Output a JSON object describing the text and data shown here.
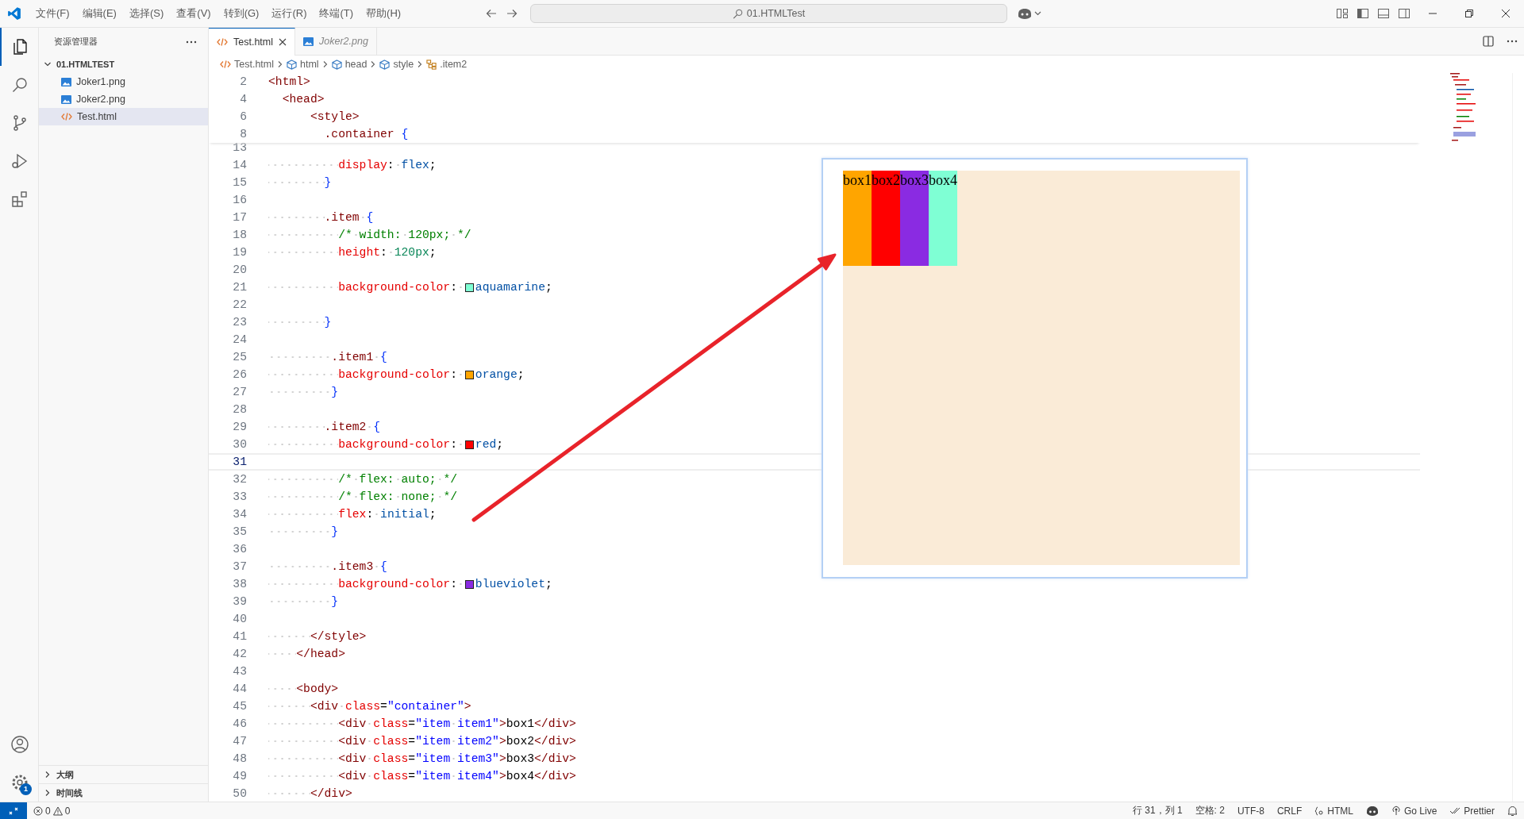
{
  "title_bar": {
    "menus": [
      "文件(F)",
      "编辑(E)",
      "选择(S)",
      "查看(V)",
      "转到(G)",
      "运行(R)",
      "终端(T)",
      "帮助(H)"
    ],
    "command_center": {
      "text": "01.HTMLTest"
    }
  },
  "activity_bar": {
    "items": [
      {
        "kind": "explorer",
        "selected": true
      },
      {
        "kind": "search",
        "selected": false
      },
      {
        "kind": "source-control",
        "selected": false
      },
      {
        "kind": "run-debug",
        "selected": false
      },
      {
        "kind": "extensions",
        "selected": false
      }
    ],
    "bottom": [
      {
        "kind": "account"
      },
      {
        "kind": "settings",
        "badge": "1"
      }
    ]
  },
  "sidebar": {
    "title": "资源管理器",
    "folder": {
      "label": "01.HTMLTEST",
      "expanded": true,
      "children": [
        {
          "label": "Joker1.png",
          "kind": "image",
          "selected": false
        },
        {
          "label": "Joker2.png",
          "kind": "image",
          "selected": false
        },
        {
          "label": "Test.html",
          "kind": "html",
          "selected": true
        }
      ]
    },
    "sections": [
      {
        "label": "大纲",
        "expanded": false
      },
      {
        "label": "时间线",
        "expanded": false
      }
    ]
  },
  "tabs": [
    {
      "label": "Test.html",
      "kind": "html",
      "selected": true,
      "preview": false
    },
    {
      "label": "Joker2.png",
      "kind": "image",
      "selected": false,
      "preview": true
    }
  ],
  "breadcrumb": [
    {
      "label": "Test.html",
      "kind": "html"
    },
    {
      "label": "html",
      "kind": "element"
    },
    {
      "label": "head",
      "kind": "element"
    },
    {
      "label": "style",
      "kind": "element"
    },
    {
      "label": ".item2",
      "kind": "selector"
    }
  ],
  "editor": {
    "sticky_lines": [
      {
        "number": "2",
        "text": "<html>"
      },
      {
        "number": "4",
        "text": "  <head>"
      },
      {
        "number": "6",
        "text": "      <style>"
      },
      {
        "number": "8",
        "text": "        .container {"
      }
    ],
    "lines": [
      {
        "number": "13",
        "current": false
      },
      {
        "number": "14",
        "current": false,
        "text": "          display: flex;"
      },
      {
        "number": "15",
        "current": false,
        "text": "        }"
      },
      {
        "number": "16",
        "current": false
      },
      {
        "number": "17",
        "current": false,
        "text": "        .item {"
      },
      {
        "number": "18",
        "current": false,
        "text": "          /* width: 120px; */"
      },
      {
        "number": "19",
        "current": false,
        "text": "          height: 120px;"
      },
      {
        "number": "20",
        "current": false
      },
      {
        "number": "21",
        "current": false,
        "text": "          background-color: aquamarine;",
        "swatch": {
          "color": "#7fffd4"
        }
      },
      {
        "number": "22",
        "current": false
      },
      {
        "number": "23",
        "current": false,
        "text": "        }"
      },
      {
        "number": "24",
        "current": false
      },
      {
        "number": "25",
        "current": false,
        "text": "         .item1 {"
      },
      {
        "number": "26",
        "current": false,
        "text": "          background-color: orange;",
        "swatch": {
          "color": "#ffa500"
        }
      },
      {
        "number": "27",
        "current": false,
        "text": "         }"
      },
      {
        "number": "28",
        "current": false
      },
      {
        "number": "29",
        "current": false,
        "text": "        .item2 {"
      },
      {
        "number": "30",
        "current": false,
        "text": "          background-color: red;",
        "swatch": {
          "color": "#ff0000"
        }
      },
      {
        "number": "31",
        "current": true
      },
      {
        "number": "32",
        "current": false,
        "text": "          /* flex: auto; */"
      },
      {
        "number": "33",
        "current": false,
        "text": "          /* flex: none; */"
      },
      {
        "number": "34",
        "current": false,
        "text": "          flex: initial;"
      },
      {
        "number": "35",
        "current": false,
        "text": "         }"
      },
      {
        "number": "36",
        "current": false
      },
      {
        "number": "37",
        "current": false,
        "text": "         .item3 {"
      },
      {
        "number": "38",
        "current": false,
        "text": "          background-color: blueviolet;",
        "swatch": {
          "color": "#8a2be2"
        }
      },
      {
        "number": "39",
        "current": false,
        "text": "         }"
      },
      {
        "number": "40",
        "current": false
      },
      {
        "number": "41",
        "current": false,
        "text": "      </style>"
      },
      {
        "number": "42",
        "current": false,
        "text": "    </head>"
      },
      {
        "number": "43",
        "current": false
      },
      {
        "number": "44",
        "current": false,
        "text": "    <body>"
      },
      {
        "number": "45",
        "current": false,
        "text": "      <div class=\"container\">"
      },
      {
        "number": "46",
        "current": false,
        "text": "          <div class=\"item item1\">box1</div>"
      },
      {
        "number": "47",
        "current": false,
        "text": "          <div class=\"item item2\">box2</div>"
      },
      {
        "number": "48",
        "current": false,
        "text": "          <div class=\"item item3\">box3</div>"
      },
      {
        "number": "49",
        "current": false,
        "text": "          <div class=\"item item4\">box4</div>"
      },
      {
        "number": "50",
        "current": false,
        "text": "      </div>"
      }
    ]
  },
  "preview": {
    "items": [
      {
        "text": "box1",
        "color": "#ffa500"
      },
      {
        "text": "box2",
        "color": "#ff0000"
      },
      {
        "text": "box3",
        "color": "#8a2be2"
      },
      {
        "text": "box4",
        "color": "#7fffd4"
      }
    ]
  },
  "status_bar": {
    "errors": "0",
    "warnings": "0",
    "items": [
      {
        "kind": "text",
        "text": "行 31，列 1"
      },
      {
        "kind": "text",
        "text": "空格: 2"
      },
      {
        "kind": "text",
        "text": "UTF-8"
      },
      {
        "kind": "text",
        "text": "CRLF"
      },
      {
        "kind": "language",
        "text": "HTML"
      },
      {
        "kind": "copilot"
      },
      {
        "kind": "live",
        "text": "Go Live"
      },
      {
        "kind": "prettier",
        "text": "Prettier"
      },
      {
        "kind": "bell"
      }
    ]
  }
}
